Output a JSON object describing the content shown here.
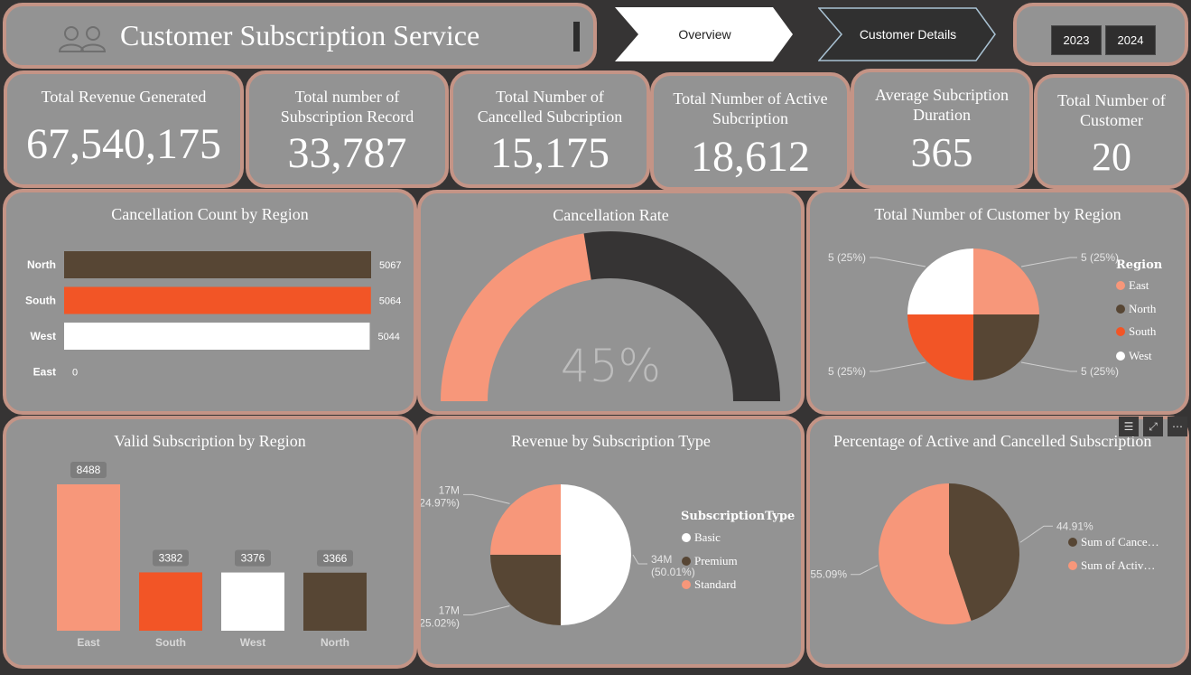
{
  "header": {
    "title": "Customer Subscription Service",
    "nav": [
      {
        "label": "Overview"
      },
      {
        "label": "Customer Details"
      }
    ],
    "years": [
      "2023",
      "2024"
    ]
  },
  "kpis": [
    {
      "title": "Total Revenue Generated",
      "value": "67,540,175"
    },
    {
      "title": "Total number of Subscription Record",
      "value": "33,787"
    },
    {
      "title": "Total Number of Cancelled Subcription",
      "value": "15,175"
    },
    {
      "title": "Total Number of Active Subcription",
      "value": "18,612"
    },
    {
      "title": "Average Subcription Duration",
      "value": "365"
    },
    {
      "title": "Total Number of Customer",
      "value": "20"
    }
  ],
  "colors": {
    "salmon": "#f7977a",
    "brown": "#574634",
    "orange": "#f25526",
    "white": "#ffffff",
    "dark": "#363434",
    "card": "#939393",
    "border": "#c49486"
  },
  "chart_data": [
    {
      "type": "bar",
      "title": "Cancellation Count by Region",
      "orientation": "horizontal",
      "categories": [
        "North",
        "South",
        "West",
        "East"
      ],
      "values": [
        5067,
        5064,
        5044,
        0
      ],
      "colors": [
        "#574634",
        "#f25526",
        "#ffffff",
        "#f7977a"
      ]
    },
    {
      "type": "gauge",
      "title": "Cancellation Rate",
      "value": 45,
      "value_label": "45%",
      "min": 0,
      "max": 100
    },
    {
      "type": "pie",
      "title": "Total Number of Customer by Region",
      "legend_title": "Region",
      "legend_position": "right",
      "slices": [
        {
          "label": "East",
          "value": 5,
          "pct_label": "5 (25%)",
          "color": "#f7977a"
        },
        {
          "label": "North",
          "value": 5,
          "pct_label": "5 (25%)",
          "color": "#574634"
        },
        {
          "label": "South",
          "value": 5,
          "pct_label": "5 (25%)",
          "color": "#f25526"
        },
        {
          "label": "West",
          "value": 5,
          "pct_label": "5 (25%)",
          "color": "#ffffff"
        }
      ]
    },
    {
      "type": "bar",
      "title": "Valid Subscription by Region",
      "orientation": "vertical",
      "categories": [
        "East",
        "South",
        "West",
        "North"
      ],
      "values": [
        8488,
        3382,
        3376,
        3366
      ],
      "colors": [
        "#f7977a",
        "#f25526",
        "#ffffff",
        "#574634"
      ]
    },
    {
      "type": "pie",
      "title": "Revenue by Subscription Type",
      "legend_title": "SubscriptionType",
      "legend_position": "right",
      "slices": [
        {
          "label": "Basic",
          "value": 50.01,
          "value_label": "34M",
          "pct_label": "(50.01%)",
          "color": "#ffffff"
        },
        {
          "label": "Premium",
          "value": 25.02,
          "value_label": "17M",
          "pct_label": "(25.02%)",
          "color": "#574634"
        },
        {
          "label": "Standard",
          "value": 24.97,
          "value_label": "17M",
          "pct_label": "(24.97%)",
          "color": "#f7977a"
        }
      ]
    },
    {
      "type": "pie",
      "title": "Percentage of Active and Cancelled Subscription",
      "legend_position": "right",
      "slices": [
        {
          "label": "Sum of Cance…",
          "value": 44.91,
          "pct_label": "44.91%",
          "color": "#574634"
        },
        {
          "label": "Sum of Activ…",
          "value": 55.09,
          "pct_label": "55.09%",
          "color": "#f7977a"
        }
      ]
    }
  ]
}
